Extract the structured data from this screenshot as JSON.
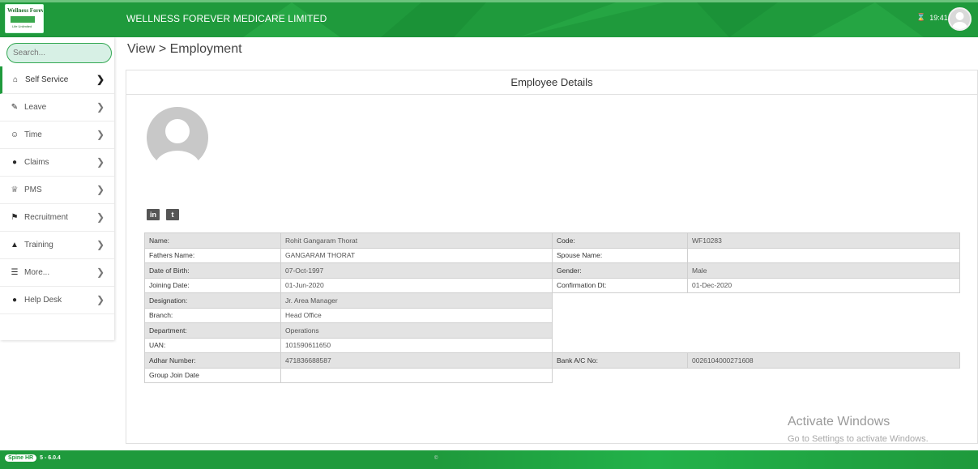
{
  "header": {
    "logo_line1": "Wellness Forever",
    "logo_line2": "Life Unlimited",
    "company_name": "WELLNESS FOREVER MEDICARE LIMITED",
    "time": "19:41",
    "accent_color": "#1f9a3c"
  },
  "sidebar": {
    "search_placeholder": "Search...",
    "items": [
      {
        "label": "Self Service",
        "icon": "home-icon"
      },
      {
        "label": "Leave",
        "icon": "edit-icon"
      },
      {
        "label": "Time",
        "icon": "users-icon"
      },
      {
        "label": "Claims",
        "icon": "info-icon"
      },
      {
        "label": "PMS",
        "icon": "trophy-icon"
      },
      {
        "label": "Recruitment",
        "icon": "recruitment-icon"
      },
      {
        "label": "Training",
        "icon": "graduation-cap-icon"
      },
      {
        "label": "More...",
        "icon": "list-icon"
      },
      {
        "label": "Help Desk",
        "icon": "info-icon"
      }
    ]
  },
  "breadcrumb": "View > Employment",
  "panel": {
    "title": "Employee Details"
  },
  "social": {
    "linkedin": "in",
    "twitter": "t"
  },
  "details": {
    "rows": [
      {
        "l1": "Name:",
        "v1": "Rohit Gangaram Thorat",
        "l2": "Code:",
        "v2": "WF10283"
      },
      {
        "l1": "Fathers Name:",
        "v1": "GANGARAM THORAT",
        "l2": "Spouse Name:",
        "v2": ""
      },
      {
        "l1": "Date of Birth:",
        "v1": "07-Oct-1997",
        "l2": "Gender:",
        "v2": "Male"
      },
      {
        "l1": "Joining Date:",
        "v1": "01-Jun-2020",
        "l2": "Confirmation Dt:",
        "v2": "01-Dec-2020"
      },
      {
        "l1": "Designation:",
        "v1": "Jr. Area Manager"
      },
      {
        "l1": "Branch:",
        "v1": "Head Office"
      },
      {
        "l1": "Department:",
        "v1": "Operations"
      },
      {
        "l1": "UAN:",
        "v1": "101590611650"
      },
      {
        "l1": "Adhar Number:",
        "v1": "471836688587",
        "l2": "Bank A/C No:",
        "v2": "0026104000271608"
      },
      {
        "l1": "Group Join Date",
        "v1": ""
      }
    ]
  },
  "watermark": {
    "line1": "Activate Windows",
    "line2": "Go to Settings to activate Windows."
  },
  "footer": {
    "brand": "Spine HR",
    "version": "5 - 6.0.4"
  }
}
